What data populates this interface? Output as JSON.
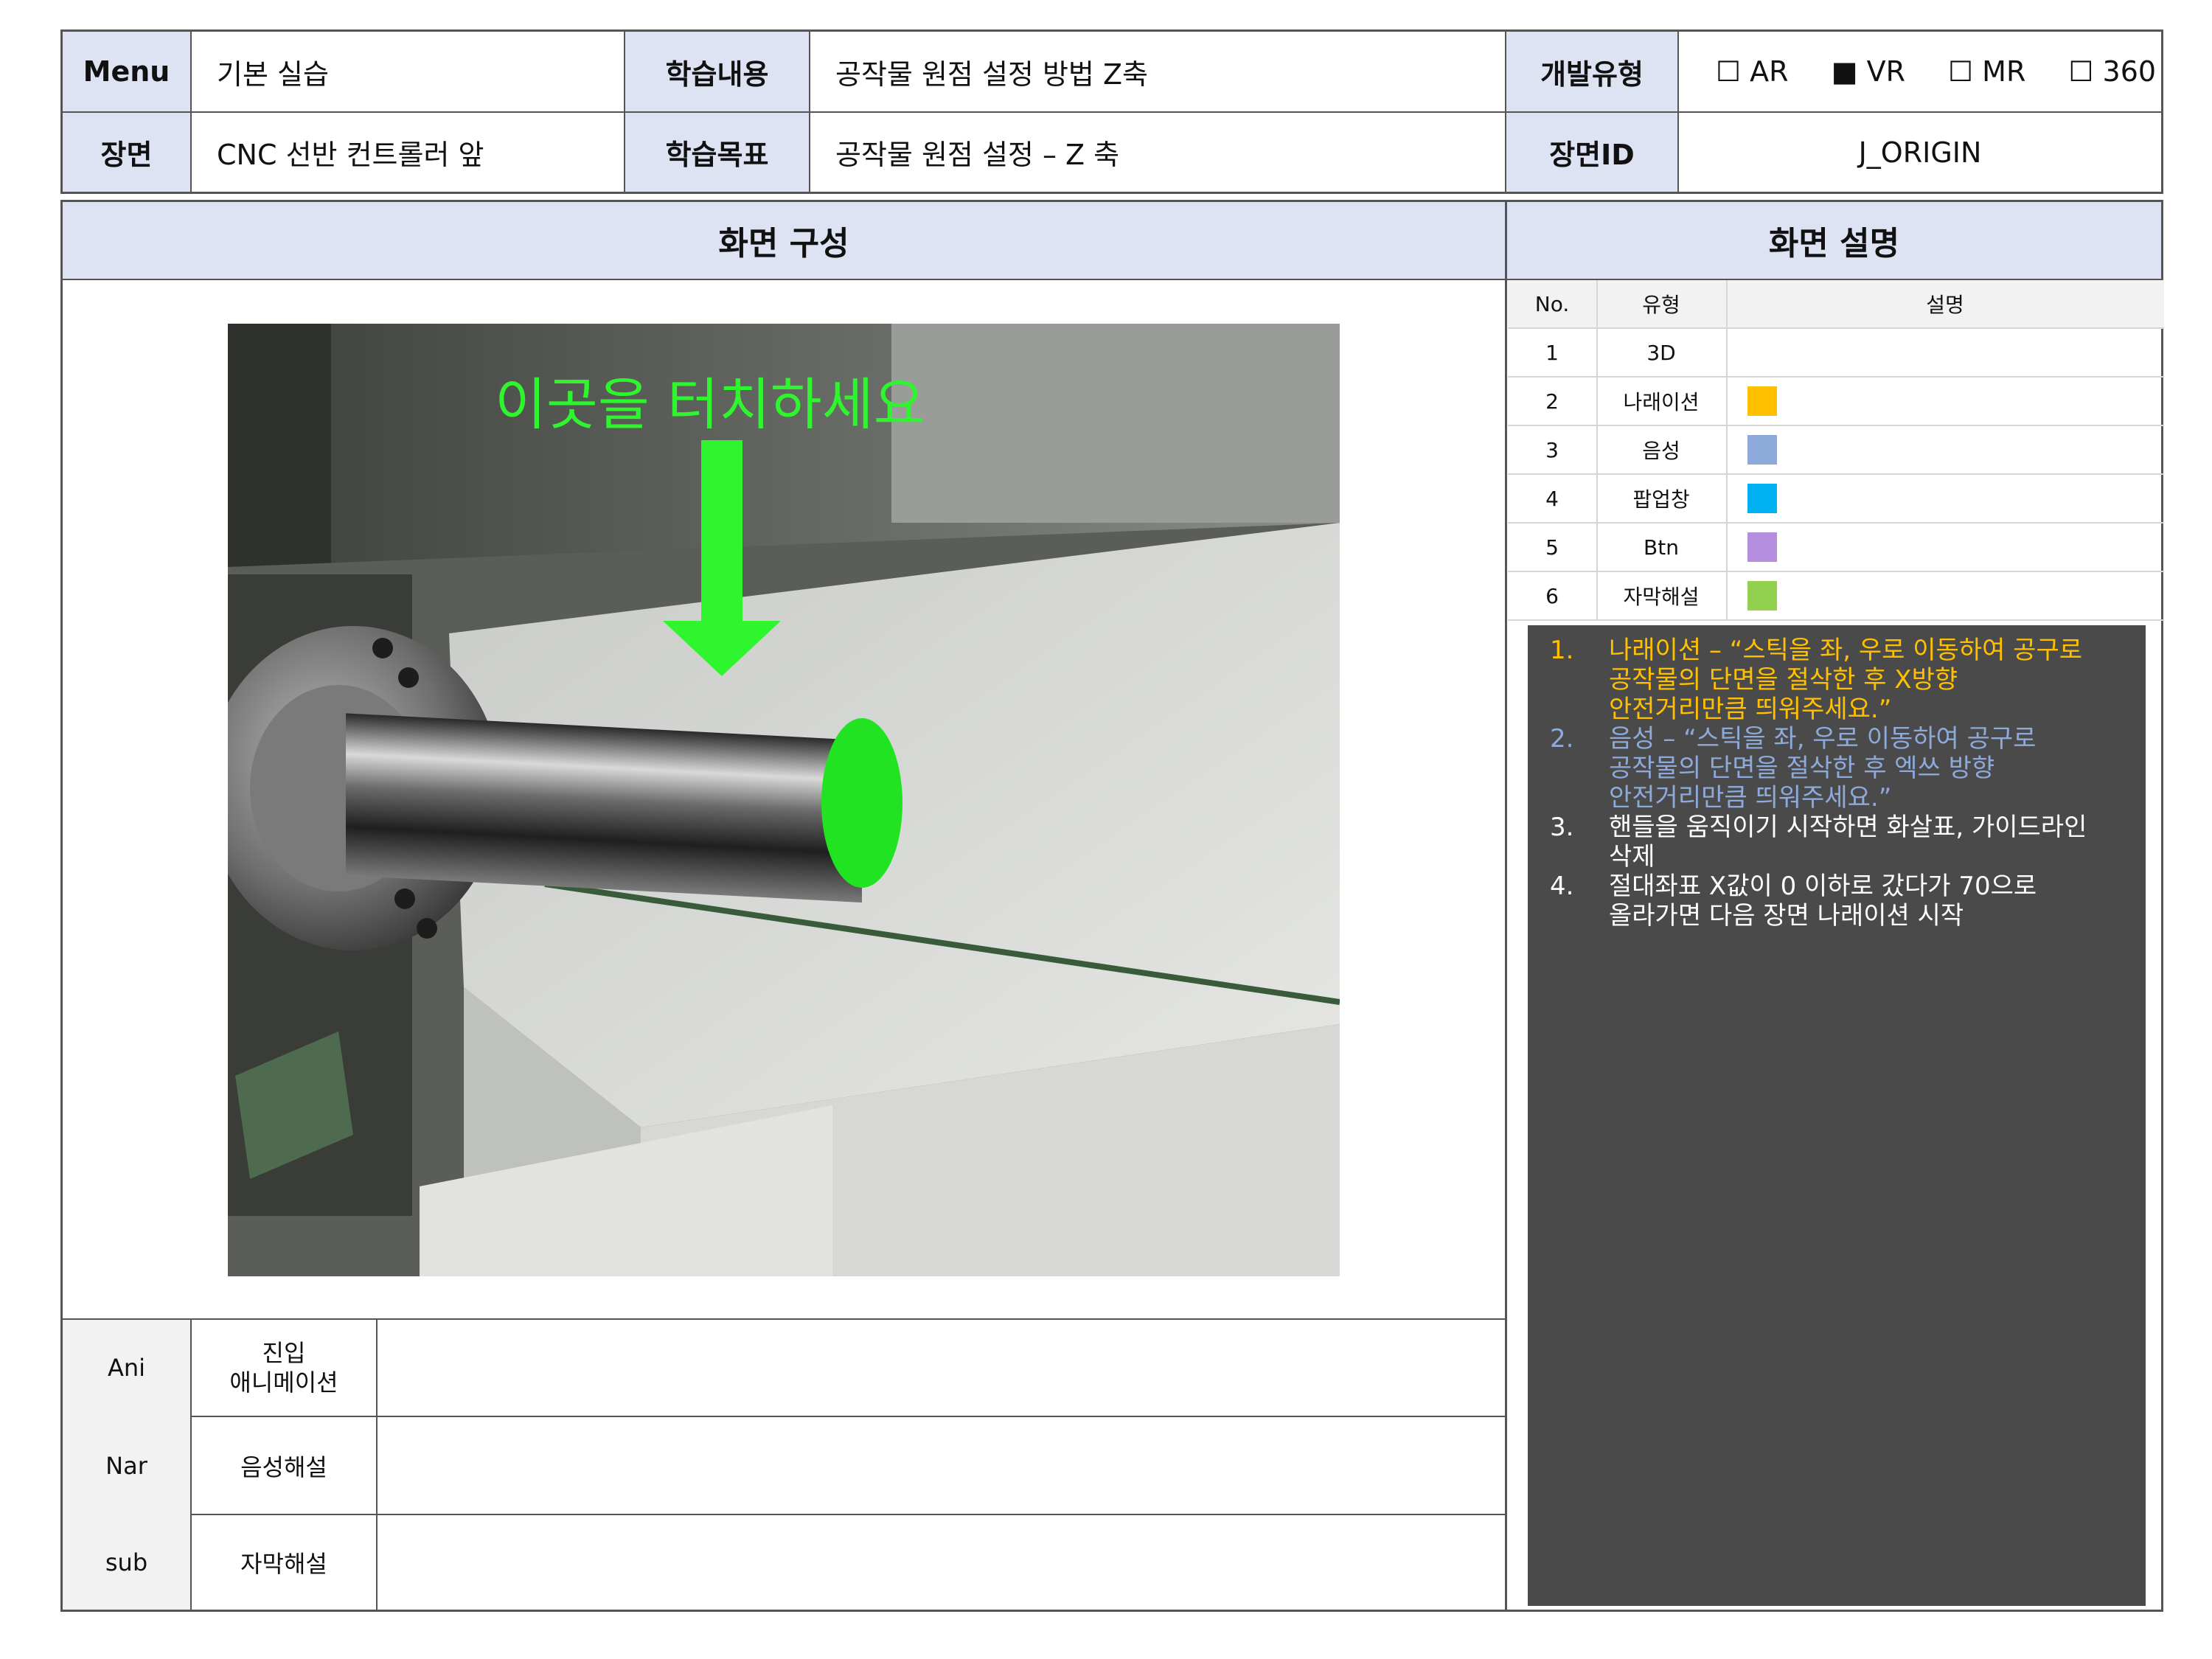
{
  "header": {
    "menu_label": "Menu",
    "menu_value": "기본 실습",
    "content_label": "학습내용",
    "content_value": "공작물 원점 설정 방법 Z축",
    "devtype_label": "개발유형",
    "devtypes": [
      {
        "mark": "☐",
        "label": "AR"
      },
      {
        "mark": "■",
        "label": "VR"
      },
      {
        "mark": "☐",
        "label": "MR"
      },
      {
        "mark": "☐",
        "label": "360"
      }
    ],
    "scene_label": "장면",
    "scene_value": "CNC 선반 컨트롤러 앞",
    "goal_label": "학습목표",
    "goal_value": "공작물 원점 설정 – Z 축",
    "sceneid_label": "장면ID",
    "sceneid_value": "J_ORIGIN"
  },
  "sections": {
    "composition_title": "화면 구성",
    "description_title": "화면 설명"
  },
  "screen": {
    "overlay_text": "이곳을 터치하세요",
    "overlay_color": "#2ef52e"
  },
  "legend": {
    "col_no": "No.",
    "col_type": "유형",
    "col_desc": "설명",
    "rows": [
      {
        "no": "1",
        "type": "3D",
        "color": ""
      },
      {
        "no": "2",
        "type": "나래이션",
        "color": "#ffc000"
      },
      {
        "no": "3",
        "type": "음성",
        "color": "#8eaadb"
      },
      {
        "no": "4",
        "type": "팝업창",
        "color": "#00b0f0"
      },
      {
        "no": "5",
        "type": "Btn",
        "color": "#b58ee0"
      },
      {
        "no": "6",
        "type": "자막해설",
        "color": "#92d050"
      }
    ]
  },
  "notes": [
    {
      "num": "1.",
      "text": "나래이션 – “스틱을 좌, 우로 이동하여 공구로\n공작물의 단면을 절삭한 후 X방향\n안전거리만큼 띄워주세요.”",
      "color": "#ffc000"
    },
    {
      "num": "2.",
      "text": "음성 – “스틱을 좌, 우로 이동하여 공구로\n공작물의 단면을 절삭한 후 엑쓰 방향\n안전거리만큼 띄워주세요.”",
      "color": "#8eaadb"
    },
    {
      "num": "3.",
      "text": "핸들을 움직이기 시작하면 화살표, 가이드라인\n삭제",
      "color": "#ffffff"
    },
    {
      "num": "4.",
      "text": "절대좌표 X값이 0 이하로 갔다가 70으로\n올라가면 다음 장면 나래이션 시작",
      "color": "#ffffff"
    }
  ],
  "bottom_rows": [
    {
      "code": "Ani",
      "label": "진입\n애니메이션",
      "value": ""
    },
    {
      "code": "Nar",
      "label": "음성해설",
      "value": ""
    },
    {
      "code": "sub",
      "label": "자막해설",
      "value": ""
    }
  ]
}
